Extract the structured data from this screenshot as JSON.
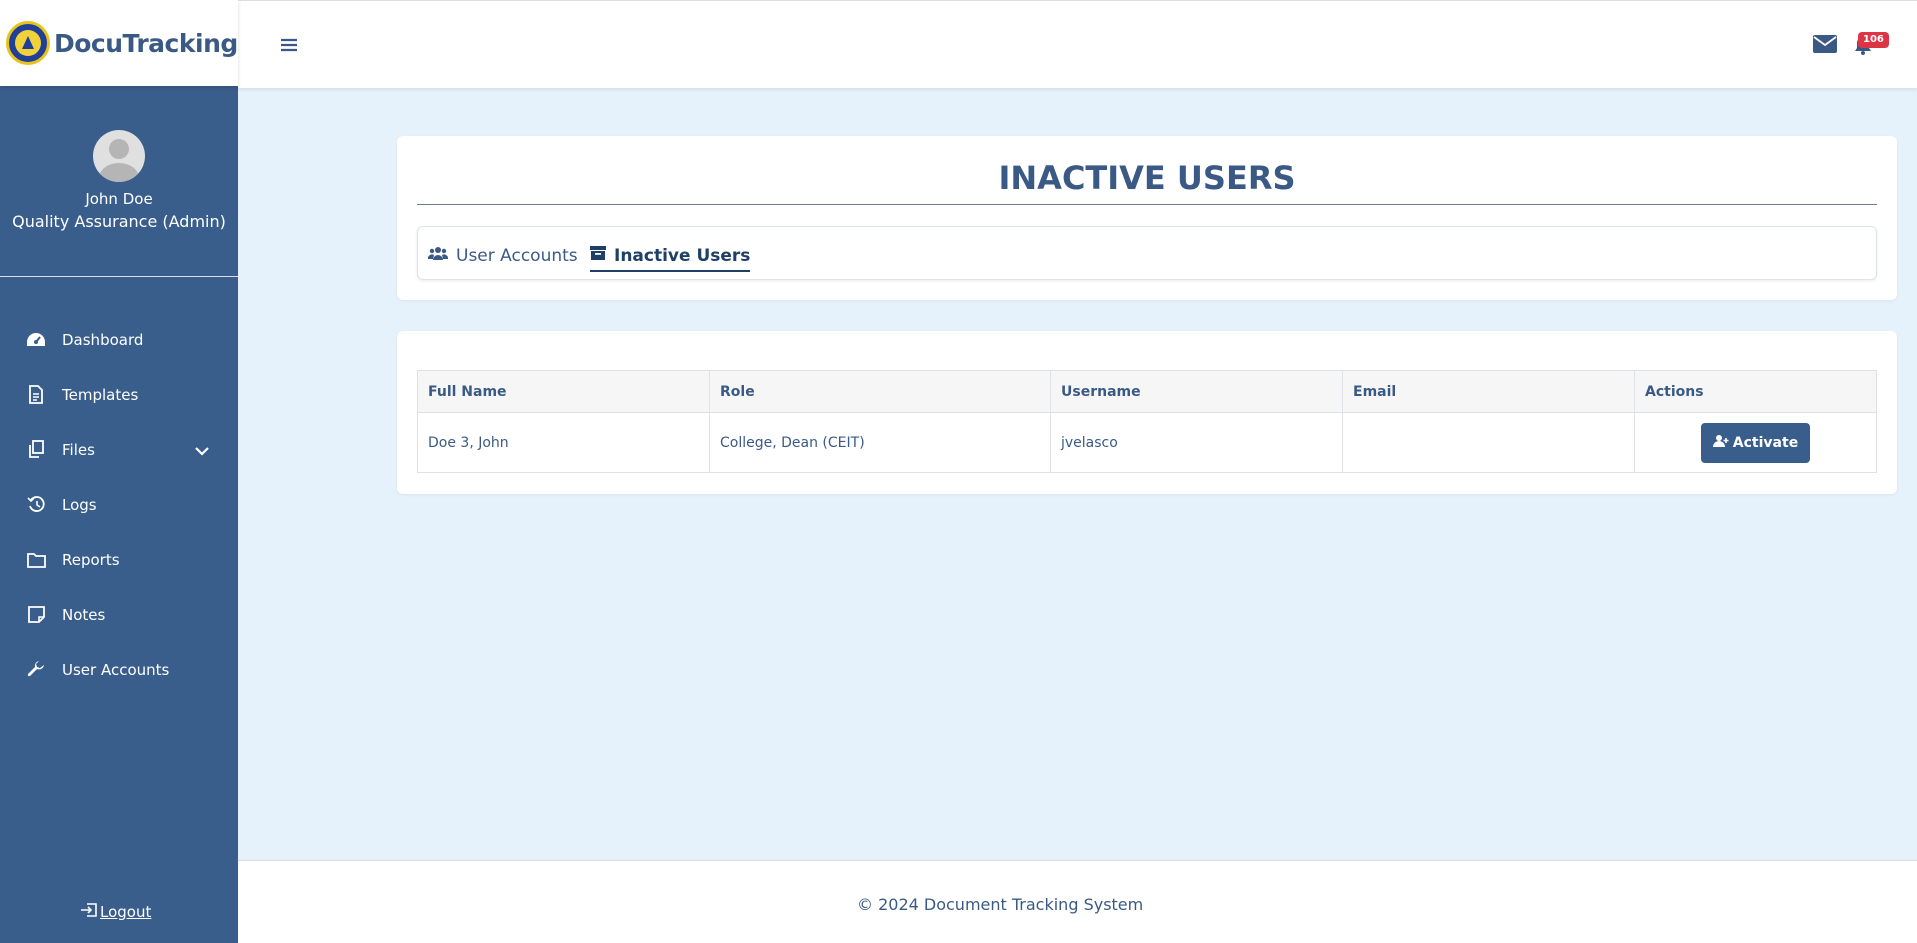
{
  "brand": {
    "name": "DocuTracking",
    "logo_icon": "university-seal-icon"
  },
  "profile": {
    "name": "John Doe",
    "role": "Quality Assurance (Admin)"
  },
  "sidebar": {
    "items": [
      {
        "label": "Dashboard",
        "icon": "dashboard-gauge-icon"
      },
      {
        "label": "Templates",
        "icon": "document-icon"
      },
      {
        "label": "Files",
        "icon": "copy-files-icon"
      },
      {
        "label": "Logs",
        "icon": "history-icon"
      },
      {
        "label": "Reports",
        "icon": "folder-icon"
      },
      {
        "label": "Notes",
        "icon": "sticky-note-icon"
      },
      {
        "label": "User Accounts",
        "icon": "wrench-icon"
      }
    ],
    "logout_label": "Logout"
  },
  "topbar": {
    "notification_count": "106"
  },
  "page": {
    "title": "INACTIVE USERS"
  },
  "tabs": [
    {
      "label": "User Accounts",
      "icon": "users-icon",
      "active": false
    },
    {
      "label": "Inactive Users",
      "icon": "archive-box-icon",
      "active": true
    }
  ],
  "table": {
    "headers": [
      "Full Name",
      "Role",
      "Username",
      "Email",
      "Actions"
    ],
    "rows": [
      {
        "full_name": "Doe 3, John",
        "role": "College, Dean (CEIT)",
        "username": "jvelasco",
        "email": "",
        "action_label": "Activate"
      }
    ]
  },
  "footer": {
    "text": "© 2024 Document Tracking System"
  },
  "colors": {
    "sidebar": "#3a5e8c",
    "background": "#e6f2fb",
    "badge": "#dc3545",
    "text": "#3a5a85"
  }
}
